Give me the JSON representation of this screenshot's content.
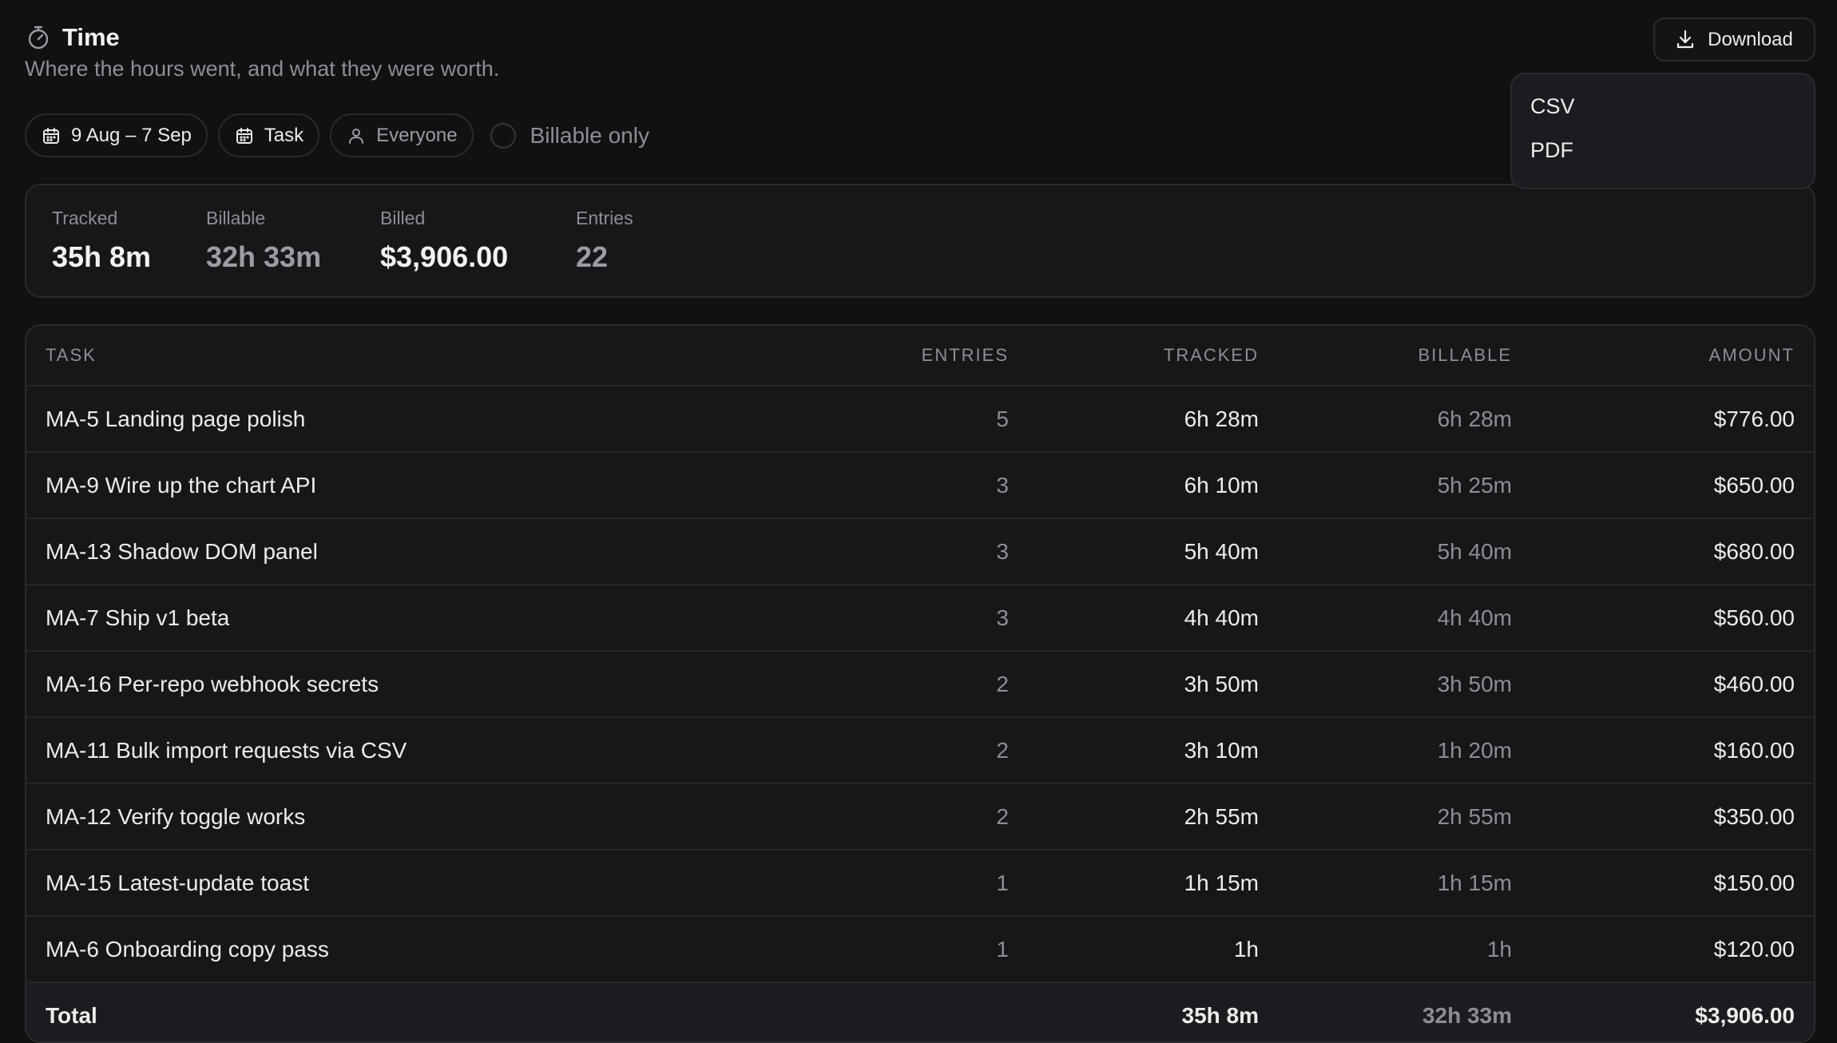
{
  "header": {
    "title": "Time",
    "subtitle": "Where the hours went, and what they were worth.",
    "title_icon": "stopwatch-icon"
  },
  "download": {
    "label": "Download",
    "icon": "download-icon",
    "menu": [
      "CSV",
      "PDF"
    ]
  },
  "filters": {
    "date_range": "9 Aug – 7 Sep",
    "group_by": "Task",
    "people": "Everyone",
    "billable_only_label": "Billable only",
    "billable_only_checked": false
  },
  "stats": [
    {
      "label": "Tracked",
      "value": "35h 8m"
    },
    {
      "label": "Billable",
      "value": "32h 33m"
    },
    {
      "label": "Billed",
      "value": "$3,906.00"
    },
    {
      "label": "Entries",
      "value": "22"
    }
  ],
  "table": {
    "columns": {
      "task": "TASK",
      "entries": "ENTRIES",
      "tracked": "TRACKED",
      "billable": "BILLABLE",
      "amount": "AMOUNT"
    },
    "rows": [
      {
        "task": "MA-5 Landing page polish",
        "entries": "5",
        "tracked": "6h 28m",
        "billable": "6h 28m",
        "amount": "$776.00"
      },
      {
        "task": "MA-9 Wire up the chart API",
        "entries": "3",
        "tracked": "6h 10m",
        "billable": "5h 25m",
        "amount": "$650.00"
      },
      {
        "task": "MA-13 Shadow DOM panel",
        "entries": "3",
        "tracked": "5h 40m",
        "billable": "5h 40m",
        "amount": "$680.00"
      },
      {
        "task": "MA-7 Ship v1 beta",
        "entries": "3",
        "tracked": "4h 40m",
        "billable": "4h 40m",
        "amount": "$560.00"
      },
      {
        "task": "MA-16 Per-repo webhook secrets",
        "entries": "2",
        "tracked": "3h 50m",
        "billable": "3h 50m",
        "amount": "$460.00"
      },
      {
        "task": "MA-11 Bulk import requests via CSV",
        "entries": "2",
        "tracked": "3h 10m",
        "billable": "1h 20m",
        "amount": "$160.00"
      },
      {
        "task": "MA-12 Verify toggle works",
        "entries": "2",
        "tracked": "2h 55m",
        "billable": "2h 55m",
        "amount": "$350.00"
      },
      {
        "task": "MA-15 Latest-update toast",
        "entries": "1",
        "tracked": "1h 15m",
        "billable": "1h 15m",
        "amount": "$150.00"
      },
      {
        "task": "MA-6 Onboarding copy pass",
        "entries": "1",
        "tracked": "1h",
        "billable": "1h",
        "amount": "$120.00"
      }
    ],
    "total": {
      "task": "Total",
      "tracked": "35h 8m",
      "billable": "32h 33m",
      "amount": "$3,906.00"
    }
  },
  "colors": {
    "background": "#111113",
    "panel": "#17171a",
    "border": "#2a2a2f",
    "text": "#ececee",
    "muted": "#8d8d95"
  }
}
